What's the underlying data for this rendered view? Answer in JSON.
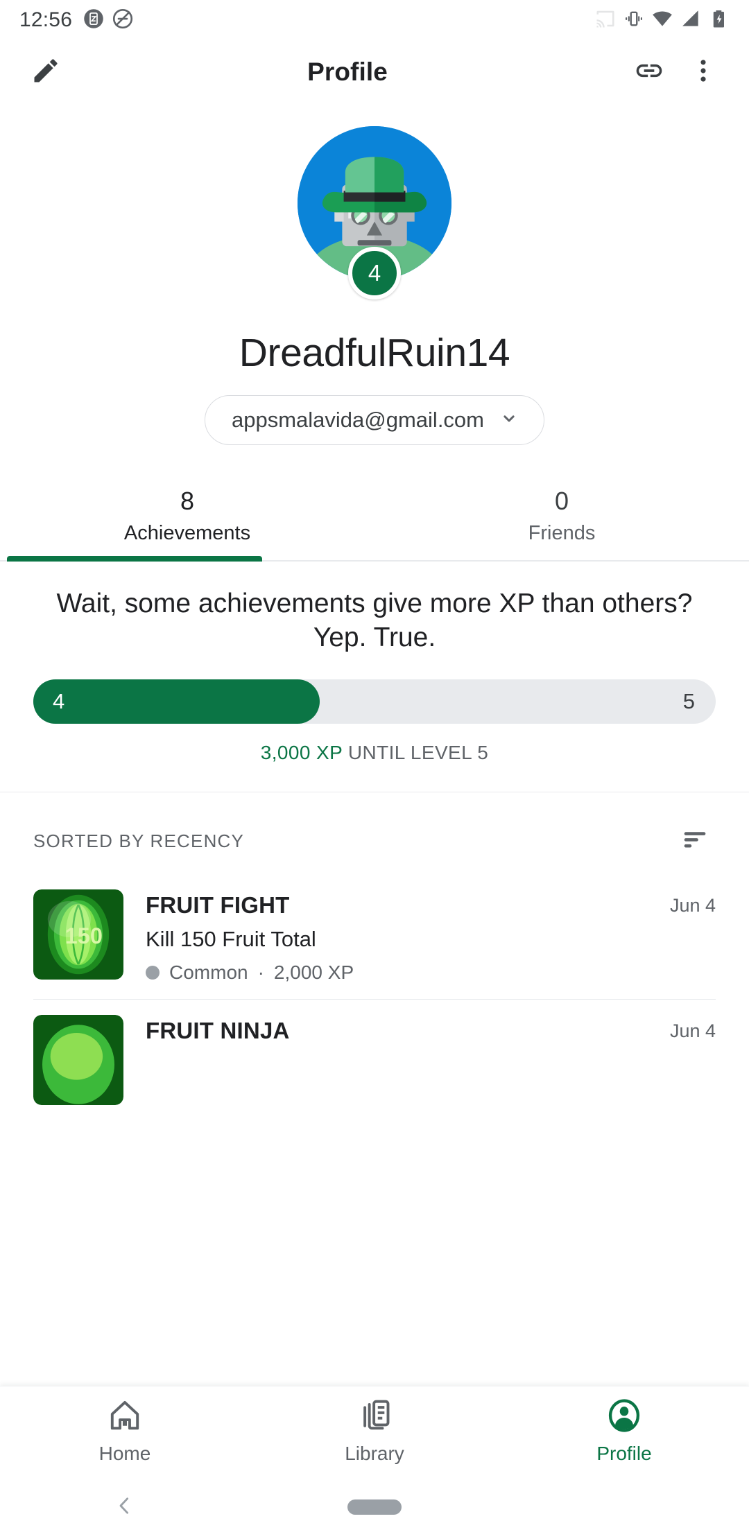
{
  "status_bar": {
    "time": "12:56",
    "left_icons": [
      "screenshot-icon",
      "do-not-disturb-icon"
    ],
    "right_icons": [
      "cast-icon",
      "vibrate-icon",
      "wifi-icon",
      "signal-icon",
      "battery-charging-icon"
    ]
  },
  "app_bar": {
    "title": "Profile",
    "edit_icon": "pencil-icon",
    "link_icon": "link-icon",
    "overflow_icon": "more-vert-icon"
  },
  "profile": {
    "avatar": "robot-avatar-with-green-hat",
    "level": "4",
    "name": "DreadfulRuin14",
    "email": "appsmalavida@gmail.com",
    "email_chevron": "chevron-down-icon"
  },
  "tabs": [
    {
      "count": "8",
      "label": "Achievements",
      "active": true
    },
    {
      "count": "0",
      "label": "Friends",
      "active": false
    }
  ],
  "xp_card": {
    "headline": "Wait, some achievements give more XP than others? Yep. True.",
    "current_level": "4",
    "next_level": "5",
    "progress_percent": 42,
    "xp_amount": "3,000 XP",
    "xp_until": " UNTIL LEVEL 5"
  },
  "sort": {
    "label": "SORTED BY RECENCY",
    "icon": "sort-icon"
  },
  "achievements": [
    {
      "icon": "fruit-fight-badge-150",
      "title": "FRUIT FIGHT",
      "description": "Kill 150 Fruit Total",
      "rarity": "Common",
      "xp": "2,000 XP",
      "meta_separator": " · ",
      "date": "Jun 4"
    },
    {
      "icon": "fruit-ninja-badge",
      "title": "FRUIT NINJA",
      "description": "",
      "rarity": "",
      "xp": "",
      "meta_separator": "",
      "date": "Jun 4"
    }
  ],
  "bottom_nav": [
    {
      "icon": "home-icon",
      "label": "Home",
      "active": false
    },
    {
      "icon": "library-icon",
      "label": "Library",
      "active": false
    },
    {
      "icon": "profile-icon",
      "label": "Profile",
      "active": true
    }
  ],
  "system_nav": {
    "back_icon": "back-chevron-icon",
    "home_pill": "home-pill-icon"
  },
  "colors": {
    "accent_green": "#0b7545",
    "avatar_blue": "#0b84d8",
    "text_primary": "#202124",
    "text_secondary": "#5f6368",
    "track_grey": "#e8eaed"
  }
}
